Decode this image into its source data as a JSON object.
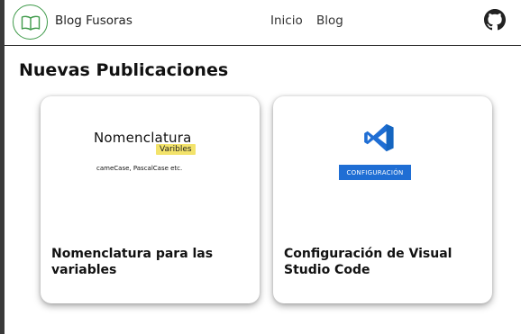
{
  "navbar": {
    "brand": "Blog Fusoras",
    "links": [
      "Inicio",
      "Blog"
    ],
    "logo_icon": "book-icon",
    "github_icon": "github-icon",
    "accent": "#3f9a4a"
  },
  "main": {
    "section_title": "Nuevas Publicaciones",
    "cards": [
      {
        "thumbnail": {
          "heading": "Nomenclatura",
          "badge": "Varibles",
          "subtext": "cameCase, PascalCase etc."
        },
        "title": "Nomenclatura para las variables"
      },
      {
        "thumbnail": {
          "icon": "vscode-icon",
          "button": "CONFIGURACIÓN"
        },
        "title": "Configuración de Visual Studio Code"
      }
    ]
  }
}
